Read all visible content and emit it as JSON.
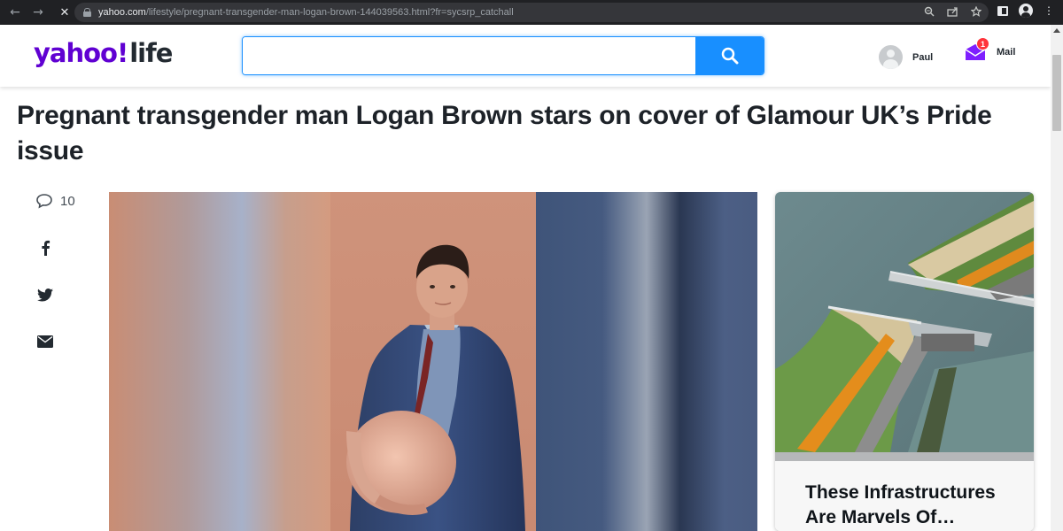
{
  "browser": {
    "url_host": "yahoo.com",
    "url_path": "/lifestyle/pregnant-transgender-man-logan-brown-144039563.html?fr=sycsrp_catchall"
  },
  "header": {
    "logo_yahoo": "yahoo",
    "logo_bang": "!",
    "logo_life": "life",
    "search_value": "",
    "user_name": "Paul",
    "mail_badge": "1",
    "mail_label": "Mail",
    "accent_color": "#6001d2",
    "search_color": "#188fff"
  },
  "article": {
    "headline": "Pregnant transgender man Logan Brown stars on cover of Glamour UK’s Pride issue",
    "comment_count": "10",
    "share_icons": [
      "facebook-icon",
      "twitter-icon",
      "email-icon"
    ]
  },
  "promo": {
    "title": "These Infrastructures Are Marvels Of…"
  }
}
